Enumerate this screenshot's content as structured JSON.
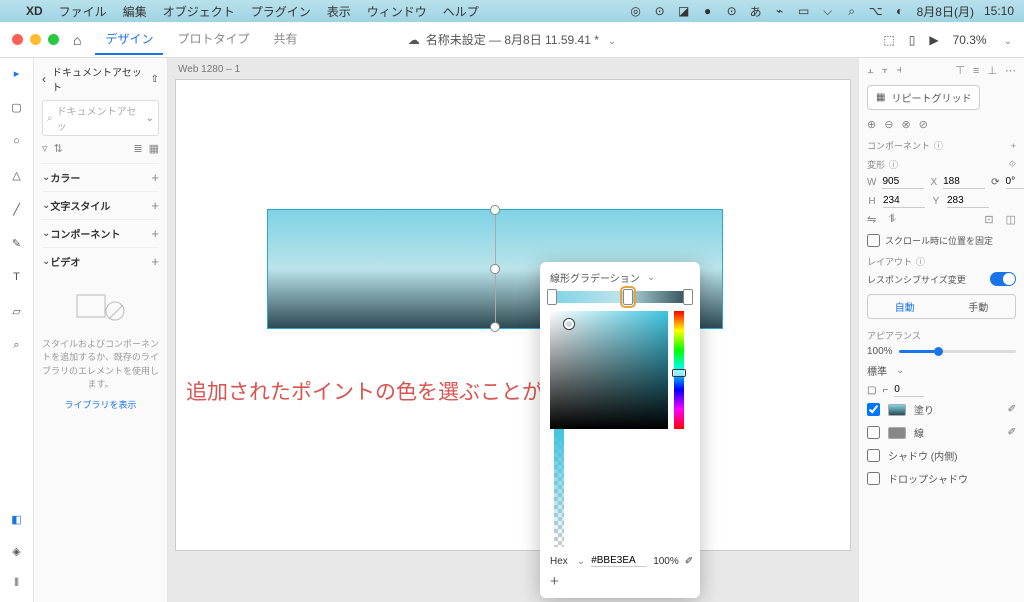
{
  "menubar": {
    "app": "XD",
    "items": [
      "ファイル",
      "編集",
      "オブジェクト",
      "プラグイン",
      "表示",
      "ウィンドウ",
      "ヘルプ"
    ],
    "date": "8月8日(月)",
    "time": "15:10"
  },
  "appbar": {
    "tabs": {
      "design": "デザイン",
      "prototype": "プロトタイプ",
      "share": "共有"
    },
    "doc_title": "名称未設定 — 8月8日 11.59.41 *",
    "zoom": "70.3%"
  },
  "assets": {
    "title": "ドキュメントアセット",
    "search_placeholder": "ドキュメントアセッ",
    "sections": {
      "color": "カラー",
      "char": "文字スタイル",
      "component": "コンポーネント",
      "video": "ビデオ"
    },
    "empty_msg": "スタイルおよびコンポーネントを追加するか、既存のライブラリのエレメントを使用します。",
    "library_link": "ライブラリを表示"
  },
  "canvas": {
    "artboard_name": "Web 1280 – 1",
    "annotation": "追加されたポイントの色を選ぶことが出来る→"
  },
  "rightpanel": {
    "repeat_grid": "リピートグリッド",
    "component_label": "コンポーネント",
    "transform_label": "変形",
    "w": "905",
    "x": "188",
    "h": "234",
    "y": "283",
    "rotation": "0°",
    "scroll_fix": "スクロール時に位置を固定",
    "layout_label": "レイアウト",
    "responsive": "レスポンシブサイズ変更",
    "seg_auto": "自動",
    "seg_manual": "手動",
    "appearance_label": "アピアランス",
    "opacity_val": "100%",
    "blend_label": "標準",
    "pass_val": "0",
    "fill_label": "塗り",
    "stroke_label": "線",
    "shadow_inner": "シャドウ (内側)",
    "shadow_drop": "ドロップシャドウ"
  },
  "picker": {
    "type_label": "線形グラデーション",
    "hex_label": "Hex",
    "hex_value": "#BBE3EA",
    "alpha_value": "100%"
  }
}
